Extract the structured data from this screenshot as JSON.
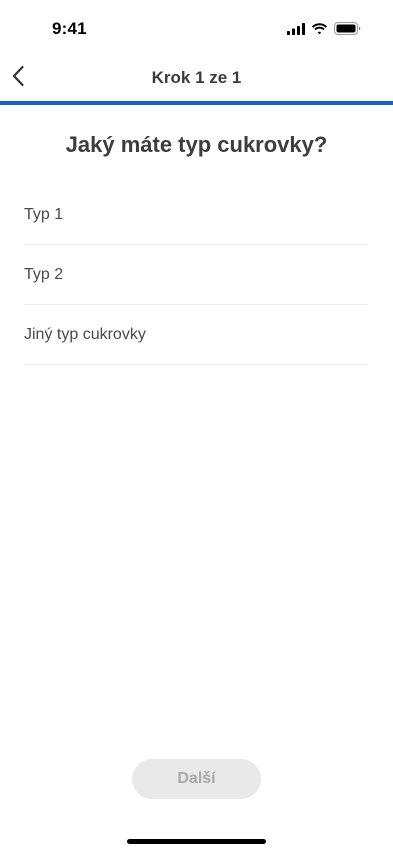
{
  "status_bar": {
    "time": "9:41",
    "icons": [
      "cellular-signal-icon",
      "wifi-icon",
      "battery-icon"
    ]
  },
  "nav": {
    "back_icon": "chevron-left-icon",
    "title": "Krok 1 ze 1",
    "progress": 1.0,
    "progress_color": "#1565c0"
  },
  "question": {
    "title": "Jaký máte typ cukrovky?"
  },
  "options": [
    {
      "label": "Typ 1"
    },
    {
      "label": "Typ 2"
    },
    {
      "label": "Jiný typ cukrovky"
    }
  ],
  "footer": {
    "next_label": "Další",
    "next_enabled": false
  }
}
